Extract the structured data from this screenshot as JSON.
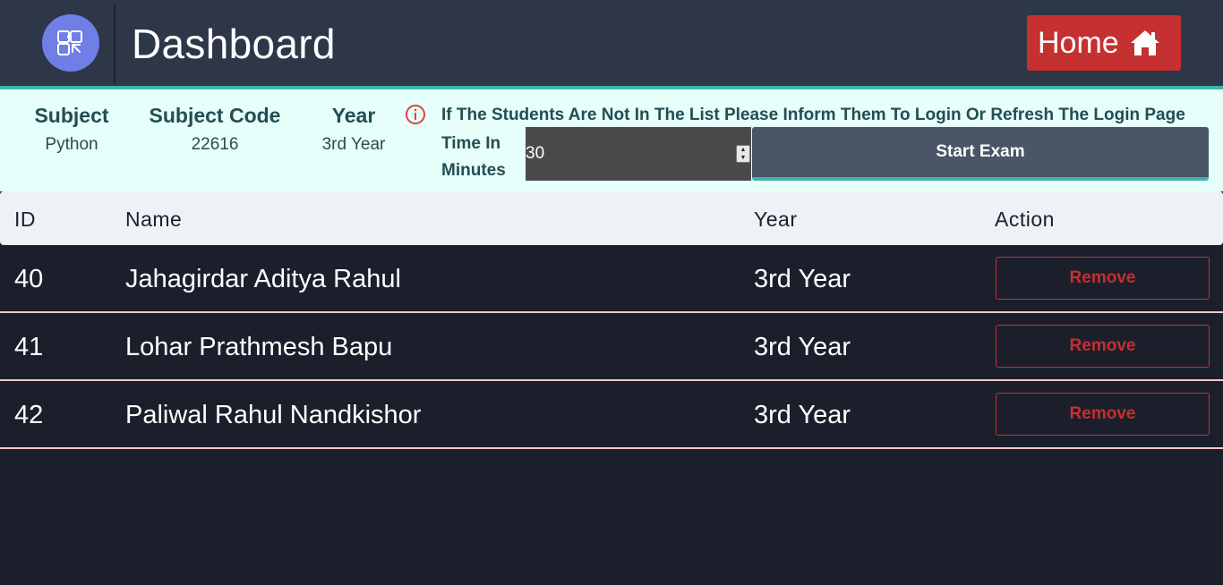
{
  "header": {
    "title": "Dashboard",
    "home_label": "Home"
  },
  "exam_info": {
    "subject_label": "Subject",
    "subject_value": "Python",
    "code_label": "Subject Code",
    "code_value": "22616",
    "year_label": "Year",
    "year_value": "3rd Year",
    "notice": "If The Students Are Not In The List Please Inform Them To Login Or Refresh The Login Page",
    "time_label": "Time In Minutes",
    "time_value": "30",
    "start_label": "Start Exam"
  },
  "table": {
    "headers": [
      "ID",
      "Name",
      "Year",
      "Action"
    ],
    "rows": [
      {
        "id": "40",
        "name": "Jahagirdar Aditya Rahul",
        "year": "3rd Year",
        "action": "Remove"
      },
      {
        "id": "41",
        "name": "Lohar Prathmesh Bapu",
        "year": "3rd Year",
        "action": "Remove"
      },
      {
        "id": "42",
        "name": "Paliwal Rahul Nandkishor",
        "year": "3rd Year",
        "action": "Remove"
      }
    ]
  },
  "colors": {
    "header_bg": "#2d3748",
    "accent_teal": "#3fb3ac",
    "panel_bg": "#e6fffa",
    "danger": "#c53030",
    "logo_bg": "#6f7fe6",
    "body_bg": "#1b1f2b"
  },
  "icons": {
    "logo": "puzzle-hand-icon",
    "home": "house-icon",
    "info": "info-circle-icon"
  }
}
